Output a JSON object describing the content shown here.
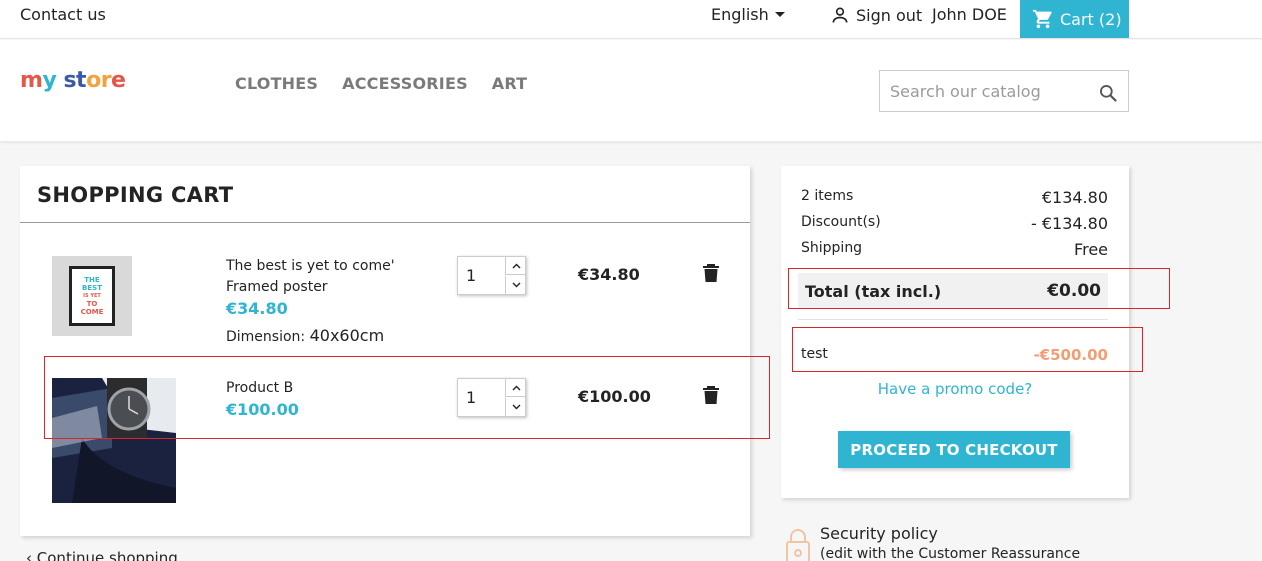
{
  "topbar": {
    "contact": "Contact us",
    "language": "English",
    "sign_out": "Sign out",
    "user_name": "John DOE",
    "cart_label": "Cart (2)"
  },
  "header": {
    "logo": "my store",
    "nav": [
      "CLOTHES",
      "ACCESSORIES",
      "ART"
    ],
    "search_placeholder": "Search our catalog"
  },
  "cart": {
    "title": "SHOPPING CART",
    "items": [
      {
        "name_line1": "The best is yet to come'",
        "name_line2": "Framed poster",
        "price": "€34.80",
        "attr_label": "Dimension:",
        "attr_value": "40x60cm",
        "quantity": "1",
        "line_total": "€34.80",
        "poster_text": [
          "THE",
          "BEST",
          "IS YET",
          "TO",
          "COME"
        ]
      },
      {
        "name_line1": "Product B",
        "price": "€100.00",
        "quantity": "1",
        "line_total": "€100.00"
      }
    ],
    "continue": "Continue shopping"
  },
  "summary": {
    "items_label": "2 items",
    "items_value": "€134.80",
    "discount_label": "Discount(s)",
    "discount_value": "- €134.80",
    "shipping_label": "Shipping",
    "shipping_value": "Free",
    "total_label": "Total (tax incl.)",
    "total_value": "€0.00",
    "voucher_name": "test",
    "voucher_value": "-€500.00",
    "promo_link": "Have a promo code?",
    "checkout": "PROCEED TO CHECKOUT"
  },
  "reassurance": {
    "title": "Security policy",
    "subtitle": "(edit with the Customer Reassurance"
  },
  "colors": {
    "accent": "#2fb5d2",
    "discount": "#f39d72",
    "annotation": "#d9262c"
  }
}
